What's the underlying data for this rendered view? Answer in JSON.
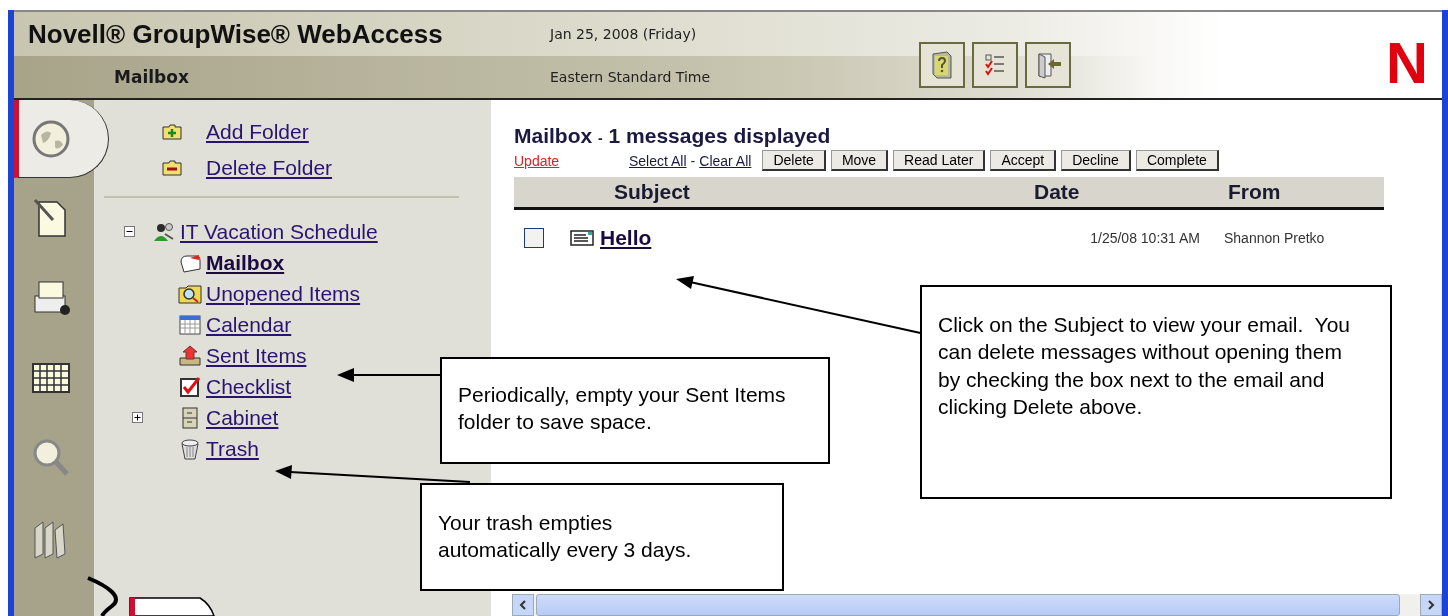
{
  "header": {
    "title": "Novell® GroupWise® WebAccess",
    "section": "Mailbox",
    "date": "Jan 25, 2008 (Friday)",
    "timezone": "Eastern Standard Time",
    "logo": "N"
  },
  "nav_tabs": [
    {
      "kind": "home",
      "selected": true
    },
    {
      "kind": "compose",
      "selected": false
    },
    {
      "kind": "addressbook",
      "selected": false
    },
    {
      "kind": "calendar",
      "selected": false
    },
    {
      "kind": "search",
      "selected": false
    },
    {
      "kind": "library",
      "selected": false
    }
  ],
  "folder_actions": [
    {
      "kind": "add",
      "label": "Add Folder"
    },
    {
      "kind": "delete",
      "label": "Delete Folder"
    }
  ],
  "folder_tree": [
    {
      "kind": "shared",
      "label": "IT Vacation Schedule",
      "selected": false,
      "expanded": true,
      "children": [
        {
          "kind": "mailbox",
          "label": "Mailbox",
          "selected": true
        },
        {
          "kind": "unopened",
          "label": "Unopened Items",
          "selected": false
        },
        {
          "kind": "calendar",
          "label": "Calendar",
          "selected": false
        },
        {
          "kind": "sent",
          "label": "Sent Items",
          "selected": false
        },
        {
          "kind": "checklist",
          "label": "Checklist",
          "selected": false
        },
        {
          "kind": "cabinet",
          "label": "Cabinet",
          "selected": false,
          "expanded": false
        },
        {
          "kind": "trash",
          "label": "Trash",
          "selected": false
        }
      ]
    }
  ],
  "message_list": {
    "title": "Mailbox",
    "title_separator": "-",
    "count": "1 messages displayed",
    "update_link": "Update",
    "select_all": "Select All",
    "separator": "-",
    "clear_all": "Clear All",
    "buttons": [
      "Delete",
      "Move",
      "Read Later",
      "Accept",
      "Decline",
      "Complete"
    ],
    "columns": [
      "Subject",
      "Date",
      "From"
    ],
    "messages": [
      {
        "checked": false,
        "subject": "Hello",
        "date": "1/25/08 10:31 AM",
        "from": "Shannon Pretko"
      }
    ]
  },
  "callouts": [
    "Periodically, empty your Sent Items folder to save space.",
    "Your trash empties automatically every 3 days.",
    "Click on the Subject to view your email.  You can delete messages without opening them by checking the box next to the email and clicking Delete above."
  ]
}
